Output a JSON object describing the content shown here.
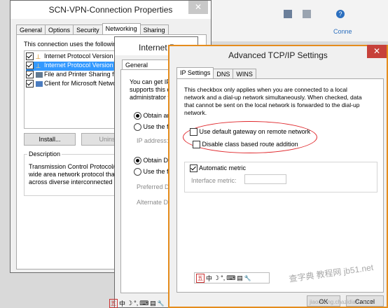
{
  "bg_app": {
    "link_text": "Conne"
  },
  "win1": {
    "title": "SCN-VPN-Connection Properties",
    "close_glyph": "✕",
    "tabs": [
      "General",
      "Options",
      "Security",
      "Networking",
      "Sharing"
    ],
    "uses_text": "This connection uses the following",
    "items": [
      {
        "label": "Internet Protocol Version 6",
        "checked": true,
        "selected": false
      },
      {
        "label": "Internet Protocol Version 4",
        "checked": true,
        "selected": true
      },
      {
        "label": "File and Printer Sharing for",
        "checked": true,
        "selected": false
      },
      {
        "label": "Client for Microsoft Network",
        "checked": true,
        "selected": false
      }
    ],
    "install_label": "Install...",
    "uninstall_label": "Unins",
    "description_title": "Description",
    "description_lines": [
      "Transmission Control Protocol/Ir",
      "wide area network protocol that",
      "across diverse interconnected n"
    ]
  },
  "win2": {
    "title": "Internet Protocol Version 4 (TCP/IPv4) Properties",
    "tab": "General",
    "intro_lines": [
      "You can get IP",
      "supports this ca",
      "administrator fo"
    ],
    "obtain_ip": "Obtain an",
    "use_following_ip": "Use the fo",
    "ip_address": "IP address:",
    "obtain_dns": "Obtain DN",
    "use_following_dns": "Use the fo",
    "preferred_dns": "Preferred DN",
    "alternate_dns": "Alternate DN"
  },
  "win3": {
    "title": "Advanced TCP/IP Settings",
    "close_glyph": "✕",
    "tabs": [
      "IP Settings",
      "DNS",
      "WINS"
    ],
    "info_lines": [
      "This checkbox only applies when you are connected to a local",
      "network and a dial-up network simultaneously.  When checked, data",
      "that cannot be sent on the local network is forwarded to the dial-up",
      "network."
    ],
    "use_default_gateway": "Use default gateway on remote network",
    "disable_class_route": "Disable class based route addition",
    "automatic_metric": "Automatic metric",
    "interface_metric": "Interface metric:",
    "ime_glyphs": [
      "五",
      "中",
      "☽",
      "°,",
      "⌨",
      "▤",
      "🔧"
    ],
    "ok_label": "OK",
    "cancel_label": "Cancel"
  },
  "bottom_ime_glyphs": [
    "五",
    "中",
    "☽",
    "°,",
    "⌨",
    "▤",
    "🔧"
  ],
  "watermark": "查字典 教程网 jb51.net",
  "watermark_url": "jiaocheng.chazidian.com",
  "colors": {
    "close_red": "#c7413a",
    "title_border": "#e58c1c",
    "annotation_red": "#e0262a",
    "selection": "#3399ff"
  }
}
